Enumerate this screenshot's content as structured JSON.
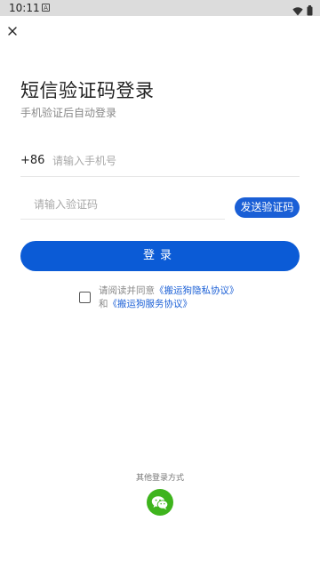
{
  "status_bar": {
    "time": "10:11",
    "notification_icon": "a-badge-icon",
    "wifi_icon": "wifi-icon",
    "battery_icon": "battery-icon"
  },
  "header": {
    "close_icon": "close-icon"
  },
  "main": {
    "title": "短信验证码登录",
    "subtitle": "手机验证后自动登录",
    "phone": {
      "country_code": "+86",
      "placeholder": "请输入手机号",
      "value": ""
    },
    "code": {
      "placeholder": "请输入验证码",
      "value": ""
    },
    "send_code_label": "发送验证码",
    "login_label": "登录",
    "agreement": {
      "checked": false,
      "prefix": "请阅读并同意",
      "privacy_link": "《搬运狗隐私协议》",
      "and": "和",
      "service_link": "《搬运狗服务协议》"
    }
  },
  "footer": {
    "other_login_label": "其他登录方式",
    "wechat_icon": "wechat-icon"
  },
  "colors": {
    "primary": "#0b5bd6",
    "link": "#1a5fd6",
    "wechat": "#3eb41d",
    "status_bar": "#dcdcdc"
  }
}
